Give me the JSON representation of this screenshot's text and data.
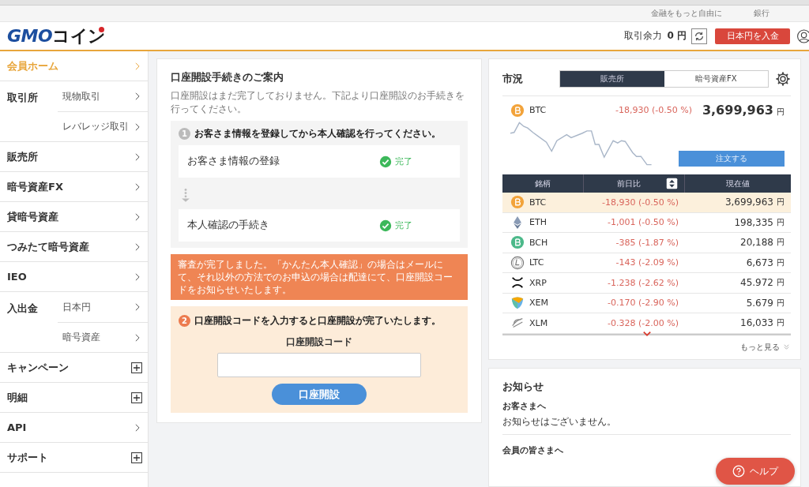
{
  "top_links": [
    "金融をもっと自由に",
    "銀行"
  ],
  "header": {
    "logo_primary": "GMO",
    "logo_secondary": "コイン",
    "balance_label": "取引余力",
    "balance_value": "0 円",
    "deposit_button": "日本円を入金"
  },
  "sidebar": {
    "items": [
      {
        "label": "会員ホーム",
        "selected": true,
        "kind": "link"
      },
      {
        "label": "取引所",
        "selected": false,
        "kind": "group",
        "children": [
          {
            "label": "現物取引"
          },
          {
            "label": "レバレッジ取引"
          }
        ]
      },
      {
        "label": "販売所",
        "selected": false,
        "kind": "link"
      },
      {
        "label": "暗号資産FX",
        "selected": false,
        "kind": "link"
      },
      {
        "label": "貸暗号資産",
        "selected": false,
        "kind": "link"
      },
      {
        "label": "つみたて暗号資産",
        "selected": false,
        "kind": "link"
      },
      {
        "label": "IEO",
        "selected": false,
        "kind": "link"
      },
      {
        "label": "入出金",
        "selected": false,
        "kind": "group",
        "children": [
          {
            "label": "日本円"
          },
          {
            "label": "暗号資産"
          }
        ]
      },
      {
        "label": "キャンペーン",
        "selected": false,
        "kind": "expand"
      },
      {
        "label": "明細",
        "selected": false,
        "kind": "expand"
      },
      {
        "label": "API",
        "selected": false,
        "kind": "link"
      },
      {
        "label": "サポート",
        "selected": false,
        "kind": "expand"
      }
    ]
  },
  "guide": {
    "title": "口座開設手続きのご案内",
    "intro": "口座開設はまだ完了しておりません。下記より口座開設のお手続きを行ってください。",
    "step1": {
      "number": "1",
      "heading": "お客さま情報を登録してから本人確認を行ってください。",
      "tasks": [
        {
          "label": "お客さま情報の登録",
          "status": "完了",
          "done": true
        },
        {
          "label": "本人確認の手続き",
          "status": "完了",
          "done": true
        }
      ]
    },
    "alert": "審査が完了しました。「かんたん本人確認」の場合はメールにて、それ以外の方法でのお申込の場合は配達にて、口座開設コードをお知らせいたします。",
    "step2": {
      "number": "2",
      "heading": "口座開設コードを入力すると口座開設が完了いたします。",
      "field_label": "口座開設コード",
      "button": "口座開設"
    }
  },
  "market": {
    "title": "市況",
    "tabs": [
      {
        "label": "販売所",
        "selected": true
      },
      {
        "label": "暗号資産FX",
        "selected": false
      }
    ],
    "featured": {
      "symbol": "BTC",
      "change": "-18,930 (-0.50 %)",
      "price": "3,699,963",
      "unit": "円",
      "order_button": "注文する"
    },
    "columns": [
      "銘柄",
      "前日比",
      "現在値"
    ],
    "rows": [
      {
        "kind": "btc",
        "symbol": "BTC",
        "change": "-18,930 (-0.50 %)",
        "price": "3,699,963",
        "unit": "円",
        "selected": true
      },
      {
        "kind": "eth",
        "symbol": "ETH",
        "change": "-1,001 (-0.50 %)",
        "price": "198,335",
        "unit": "円",
        "selected": false
      },
      {
        "kind": "bch",
        "symbol": "BCH",
        "change": "-385 (-1.87 %)",
        "price": "20,188",
        "unit": "円",
        "selected": false
      },
      {
        "kind": "ltc",
        "symbol": "LTC",
        "change": "-143 (-2.09 %)",
        "price": "6,673",
        "unit": "円",
        "selected": false
      },
      {
        "kind": "xrp",
        "symbol": "XRP",
        "change": "-1.238 (-2.62 %)",
        "price": "45.972",
        "unit": "円",
        "selected": false
      },
      {
        "kind": "xem",
        "symbol": "XEM",
        "change": "-0.170 (-2.90 %)",
        "price": "5.679",
        "unit": "円",
        "selected": false
      },
      {
        "kind": "xlm",
        "symbol": "XLM",
        "change": "-0.328 (-2.00 %)",
        "price": "16,033",
        "unit": "円",
        "selected": false
      }
    ],
    "more": "もっと見る"
  },
  "notices": {
    "title": "お知らせ",
    "sections": [
      {
        "heading": "お客さまへ",
        "body": "お知らせはございません。"
      },
      {
        "heading": "会員の皆さまへ"
      }
    ]
  },
  "help_button": "ヘルプ"
}
